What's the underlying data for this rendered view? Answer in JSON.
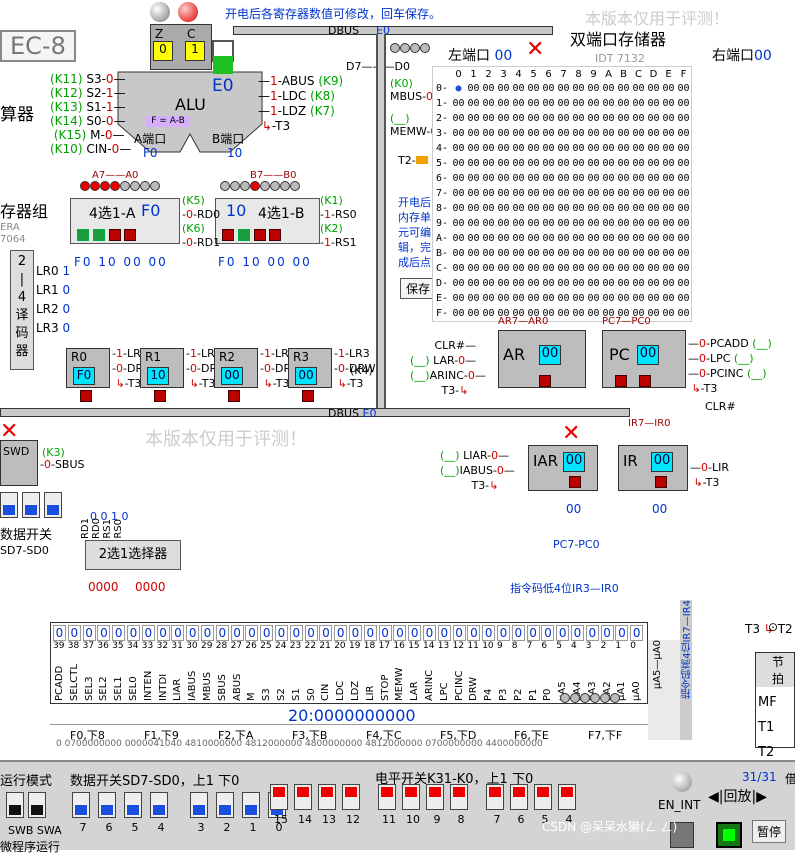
{
  "header": {
    "notice": "开电后各寄存器数值可修改，回车保存。",
    "watermark": "本版本仅用于评测！",
    "left_logo": "EC-8"
  },
  "flags": {
    "z_label": "Z",
    "c_label": "C",
    "z_val": "0",
    "c_val": "1",
    "z_out": "0",
    "c_out": "1"
  },
  "alu": {
    "title": "ALU",
    "output": "E0",
    "formula": "F = A-B",
    "a_port": "A端口",
    "b_port": "B端口",
    "a_val": "F0",
    "b_val": "10",
    "left_ctrl": [
      {
        "k": "(K11)",
        "n": "S3",
        "v": "0"
      },
      {
        "k": "(K12)",
        "n": "S2",
        "v": "1"
      },
      {
        "k": "(K13)",
        "n": "S1",
        "v": "1"
      },
      {
        "k": "(K14)",
        "n": "S0",
        "v": "0"
      },
      {
        "k": "(K15)",
        "n": "M",
        "v": "0"
      },
      {
        "k": "(K10)",
        "n": "CIN",
        "v": "0"
      }
    ],
    "right_ctrl": [
      {
        "k": "(K9)",
        "n": "ABUS",
        "v": "1"
      },
      {
        "k": "(K8)",
        "n": "LDC",
        "v": "1"
      },
      {
        "k": "(K7)",
        "n": "LDZ",
        "v": "1"
      }
    ],
    "t3": "T3",
    "side_label": "算器"
  },
  "dbus": {
    "label": "DBUS",
    "value": "E0",
    "d7_d0": "D7———D0"
  },
  "mux4": {
    "a_title": "4选1-A",
    "a_val": "F0",
    "b_title": "4选1-B",
    "b_val": "10",
    "a_ticks": "A7——A0",
    "b_ticks": "B7——B0",
    "rd0": "RD0",
    "rd1": "RD1",
    "rs0": "RS0",
    "rs1": "RS1",
    "k5": "(K5)",
    "k6": "(K6)",
    "k1": "(K1)",
    "k2": "(K2)",
    "rd0v": "0",
    "rd1v": "0",
    "rs0v": "1",
    "rs1v": "1",
    "a_outs": [
      "F0",
      "10",
      "00",
      "00"
    ],
    "b_outs": [
      "F0",
      "10",
      "00",
      "00"
    ]
  },
  "regs": [
    {
      "name": "R0",
      "val": "F0",
      "ld": "LR0",
      "ldv": "1"
    },
    {
      "name": "R1",
      "val": "10",
      "ld": "LR1",
      "ldv": "1"
    },
    {
      "name": "R2",
      "val": "00",
      "ld": "LR2",
      "ldv": "1"
    },
    {
      "name": "R3",
      "val": "00",
      "ld": "LR3",
      "ldv": "1"
    }
  ],
  "reg_common": {
    "drw": "DRW",
    "t3": "T3",
    "k4": "(K4)"
  },
  "decoder": {
    "group_label": "存器组",
    "era": "ERA",
    "num": "7064",
    "title": "2—4译码器",
    "outs": [
      "LR0",
      "LR1",
      "LR2",
      "LR3"
    ],
    "vals": [
      "1",
      "0",
      "0",
      "0"
    ]
  },
  "swd": {
    "label": "SWD",
    "sbus": "SBUS",
    "k3": "(K3)",
    "v": "0",
    "data_switch": "数据开关",
    "sd": "SD7-SD0"
  },
  "mem": {
    "title": "双端口存储器",
    "chip": "IDT 7132",
    "left_port": "左端口",
    "left_val": "00",
    "right_port": "右端口",
    "right_val": "00",
    "k0": "(K0)",
    "mbus": "MBUS",
    "memw": "MEMW",
    "t2": "T2",
    "cols": [
      "0",
      "1",
      "2",
      "3",
      "4",
      "5",
      "6",
      "7",
      "8",
      "9",
      "A",
      "B",
      "C",
      "D",
      "E",
      "F"
    ],
    "rows": [
      "0",
      "1",
      "2",
      "3",
      "4",
      "5",
      "6",
      "7",
      "8",
      "9",
      "A",
      "B",
      "C",
      "D",
      "E",
      "F"
    ],
    "cell": "00",
    "first_cell": "●",
    "hint": [
      "开电后",
      "内存单",
      "元可编",
      "辑，完",
      "成后点"
    ],
    "save": "保存"
  },
  "ar": {
    "name": "AR",
    "val": "00",
    "ticks": "AR7—AR0",
    "clr": "CLR#",
    "lar": "LAR",
    "arinc": "ARINC",
    "t3": "T3"
  },
  "pc": {
    "name": "PC",
    "val": "00",
    "ticks": "PC7—PC0",
    "pcadd": "PCADD",
    "lpc": "LPC",
    "pcinc": "PCINC",
    "t3": "T3",
    "clr": "CLR#"
  },
  "iar": {
    "name": "IAR",
    "val": "00",
    "liar": "LIAR",
    "iabus": "IABUS",
    "t3": "T3"
  },
  "ir": {
    "name": "IR",
    "val": "00",
    "ticks": "IR7—IR0",
    "lir": "LIR",
    "t3": "T3"
  },
  "pc_bus": "PC7-PC0",
  "mux2": {
    "title": "2选1选择器",
    "labels": [
      "RD1",
      "RD0",
      "RS1",
      "RS0"
    ],
    "vals": [
      "0",
      "0",
      "1",
      "0"
    ],
    "outs": "0000",
    "outs2": "0000"
  },
  "ir_low": "指令码低4位IR3—IR0",
  "ir_high": "指令码高4位IR7—IR4",
  "ctrl": {
    "vals": [
      "0",
      "0",
      "0",
      "0",
      "0",
      "0",
      "0",
      "0",
      "0",
      "0",
      "0",
      "0",
      "0",
      "0",
      "0",
      "0",
      "0",
      "0",
      "0",
      "0",
      "0",
      "0",
      "0",
      "0",
      "0",
      "0",
      "0",
      "0",
      "0",
      "0",
      "0",
      "0",
      "0",
      "0",
      "0",
      "0",
      "0",
      "0",
      "0",
      "0",
      "0",
      "0",
      "0",
      "0",
      "0",
      "0",
      "0",
      "0",
      "0"
    ],
    "nums": [
      "39",
      "38",
      "37",
      "36",
      "35",
      "34",
      "33",
      "32",
      "31",
      "30",
      "29",
      "28",
      "27",
      "26",
      "25",
      "24",
      "23",
      "22",
      "21",
      "20",
      "19",
      "18",
      "17",
      "16",
      "15",
      "14",
      "13",
      "12",
      "11",
      "10",
      "9",
      "8",
      "7",
      "6",
      "5",
      "4",
      "3",
      "2",
      "1",
      "0"
    ],
    "names": [
      "PCADD",
      "SELCTL",
      "SEL3",
      "SEL2",
      "SEL1",
      "SEL0",
      "INTEN",
      "INTDI",
      "LIAR",
      "IABUS",
      "MBUS",
      "SBUS",
      "ABUS",
      "M",
      "S3",
      "S2",
      "S1",
      "S0",
      "CIN",
      "LDC",
      "LDZ",
      "LIR",
      "STOP",
      "MEMW",
      "LAR",
      "ARINC",
      "LPC",
      "PCINC",
      "DRW",
      "P4",
      "P3",
      "P2",
      "P1",
      "P0",
      "µA5",
      "µA4",
      "µA3",
      "µA2",
      "µA1",
      "µA0"
    ],
    "address": "20:0000000000",
    "nuao": "µA5—µA0",
    "p0": "P0"
  },
  "micro_tabs": [
    "F0,下8",
    "F1,下9",
    "F2,下A",
    "F3,下B",
    "F4,下C",
    "F5,下D",
    "F6,下E",
    "F7,下F"
  ],
  "micro_rows": [
    "0",
    "0700000000",
    "0000041040",
    "4810000000",
    "4812000000",
    "4800000000",
    "4812000000",
    "0700000000",
    "4400000000"
  ],
  "clock": {
    "t3": "T3",
    "t2": "T2",
    "beat": "节拍",
    "mf": "MF",
    "t1": "T1",
    "t2b": "T2"
  },
  "bottom": {
    "mode_label": "运行模式",
    "swb": "SWB",
    "swa": "SWA",
    "mode2": "微程序运行",
    "data_switch": "数据开关SD7-SD0，上1 下0",
    "data_nums": [
      "7",
      "6",
      "5",
      "4",
      "3",
      "2",
      "1",
      "0"
    ],
    "level_switch": "电平开关K31-K0，上1 下0",
    "level_nums": [
      "15",
      "14",
      "13",
      "12",
      "11",
      "10",
      "9",
      "8",
      "7",
      "6",
      "5",
      "4"
    ],
    "en_int": "EN_INT",
    "replay": "回放",
    "progress": "31/31",
    "pause": "暂停",
    "csdn": "CSDN @呆呆水獭(ㄥ ㄥ)",
    "right_edge": "借"
  },
  "colors": {
    "cyan": "#00e5ff",
    "green": "#1a9b3c",
    "red": "#cc0000",
    "blue": "#0033cc"
  }
}
